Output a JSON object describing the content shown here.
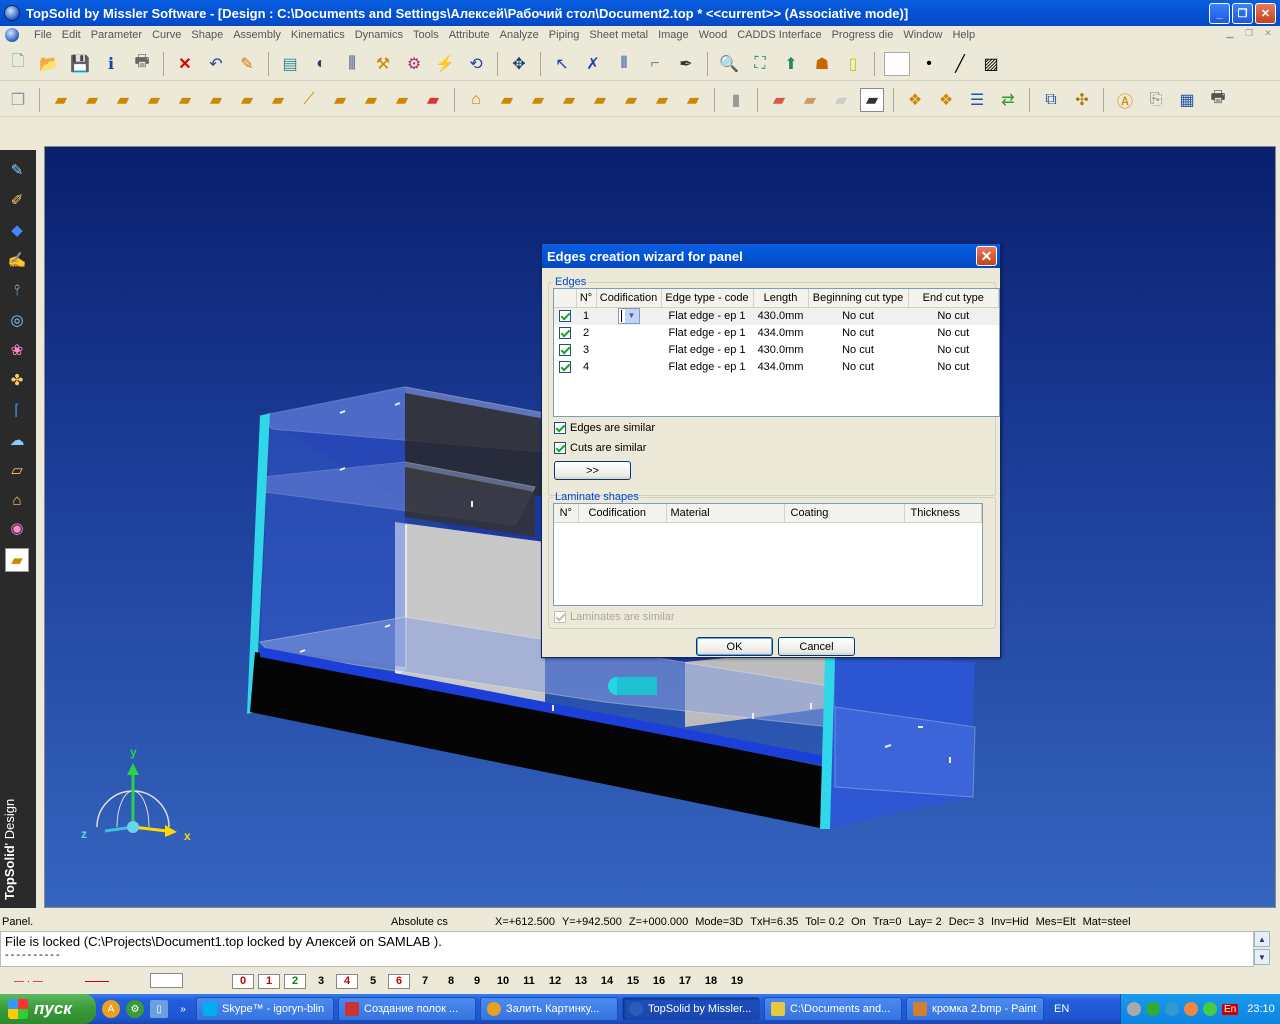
{
  "window": {
    "title": "TopSolid by Missler Software - [Design : C:\\Documents and Settings\\Алексей\\Рабочий стол\\Document2.top *  <<current>> (Associative mode)]"
  },
  "menu": [
    "File",
    "Edit",
    "Parameter",
    "Curve",
    "Shape",
    "Assembly",
    "Kinematics",
    "Dynamics",
    "Tools",
    "Attribute",
    "Analyze",
    "Piping",
    "Sheet metal",
    "Image",
    "Wood",
    "CADDS Interface",
    "Progress die",
    "Window",
    "Help"
  ],
  "sidebar": {
    "brand_main": "TopSolid",
    "brand_sub": "' Design"
  },
  "axes": {
    "y": "y",
    "x": "x",
    "z": "z"
  },
  "dialog": {
    "title": "Edges creation wizard for panel",
    "edges_legend": "Edges",
    "edge_columns": [
      "N°",
      "Codification",
      "Edge type - code",
      "Length",
      "Beginning cut type",
      "End cut type"
    ],
    "edges": [
      {
        "n": "1",
        "type": "Flat edge - ep 1",
        "length": "430.0mm",
        "begin": "No cut",
        "end": "No cut"
      },
      {
        "n": "2",
        "type": "Flat edge - ep 1",
        "length": "434.0mm",
        "begin": "No cut",
        "end": "No cut"
      },
      {
        "n": "3",
        "type": "Flat edge - ep 1",
        "length": "430.0mm",
        "begin": "No cut",
        "end": "No cut"
      },
      {
        "n": "4",
        "type": "Flat edge - ep 1",
        "length": "434.0mm",
        "begin": "No cut",
        "end": "No cut"
      }
    ],
    "edges_similar": "Edges are similar",
    "cuts_similar": "Cuts are similar",
    "more_button": ">>",
    "laminate_legend": "Laminate shapes",
    "laminate_columns": [
      "N°",
      "Codification",
      "Material",
      "Coating",
      "Thickness"
    ],
    "laminates_similar": "Laminates are similar",
    "ok": "OK",
    "cancel": "Cancel"
  },
  "status": {
    "left": "Panel.",
    "cs": "Absolute cs",
    "values": [
      "X=+612.500",
      "Y=+942.500",
      "Z=+000.000",
      "Mode=3D",
      "TxH=6.35",
      "Tol=  0.2",
      "On",
      "Tra=0",
      "Lay=  2",
      "Dec= 3",
      "Inv=Hid",
      "Mes=Elt",
      "Mat=steel"
    ]
  },
  "message": {
    "line1": "File is locked (C:\\Projects\\Document1.top locked by Алексей on SAMLAB ).",
    "line2": "----------"
  },
  "layers": [
    "0",
    "1",
    "2",
    "3",
    "4",
    "5",
    "6",
    "7",
    "8",
    "9",
    "10",
    "11",
    "12",
    "13",
    "14",
    "15",
    "16",
    "17",
    "18",
    "19"
  ],
  "taskbar": {
    "start": "пуск",
    "tasks": [
      {
        "label": "Skype™ - igoryn-blin",
        "color": "#00aff0"
      },
      {
        "label": "Создание полок ...",
        "color": "#c33"
      },
      {
        "label": "Залить Картинку...",
        "color": "#e8a020"
      },
      {
        "label": "TopSolid by Missler...",
        "color": "#2a5db8"
      },
      {
        "label": "C:\\Documents and...",
        "color": "#e8c840"
      },
      {
        "label": "кромка 2.bmp - Paint",
        "color": "#d08030"
      }
    ],
    "lang": "EN",
    "tray_lang": "En",
    "clock": "23:10"
  }
}
